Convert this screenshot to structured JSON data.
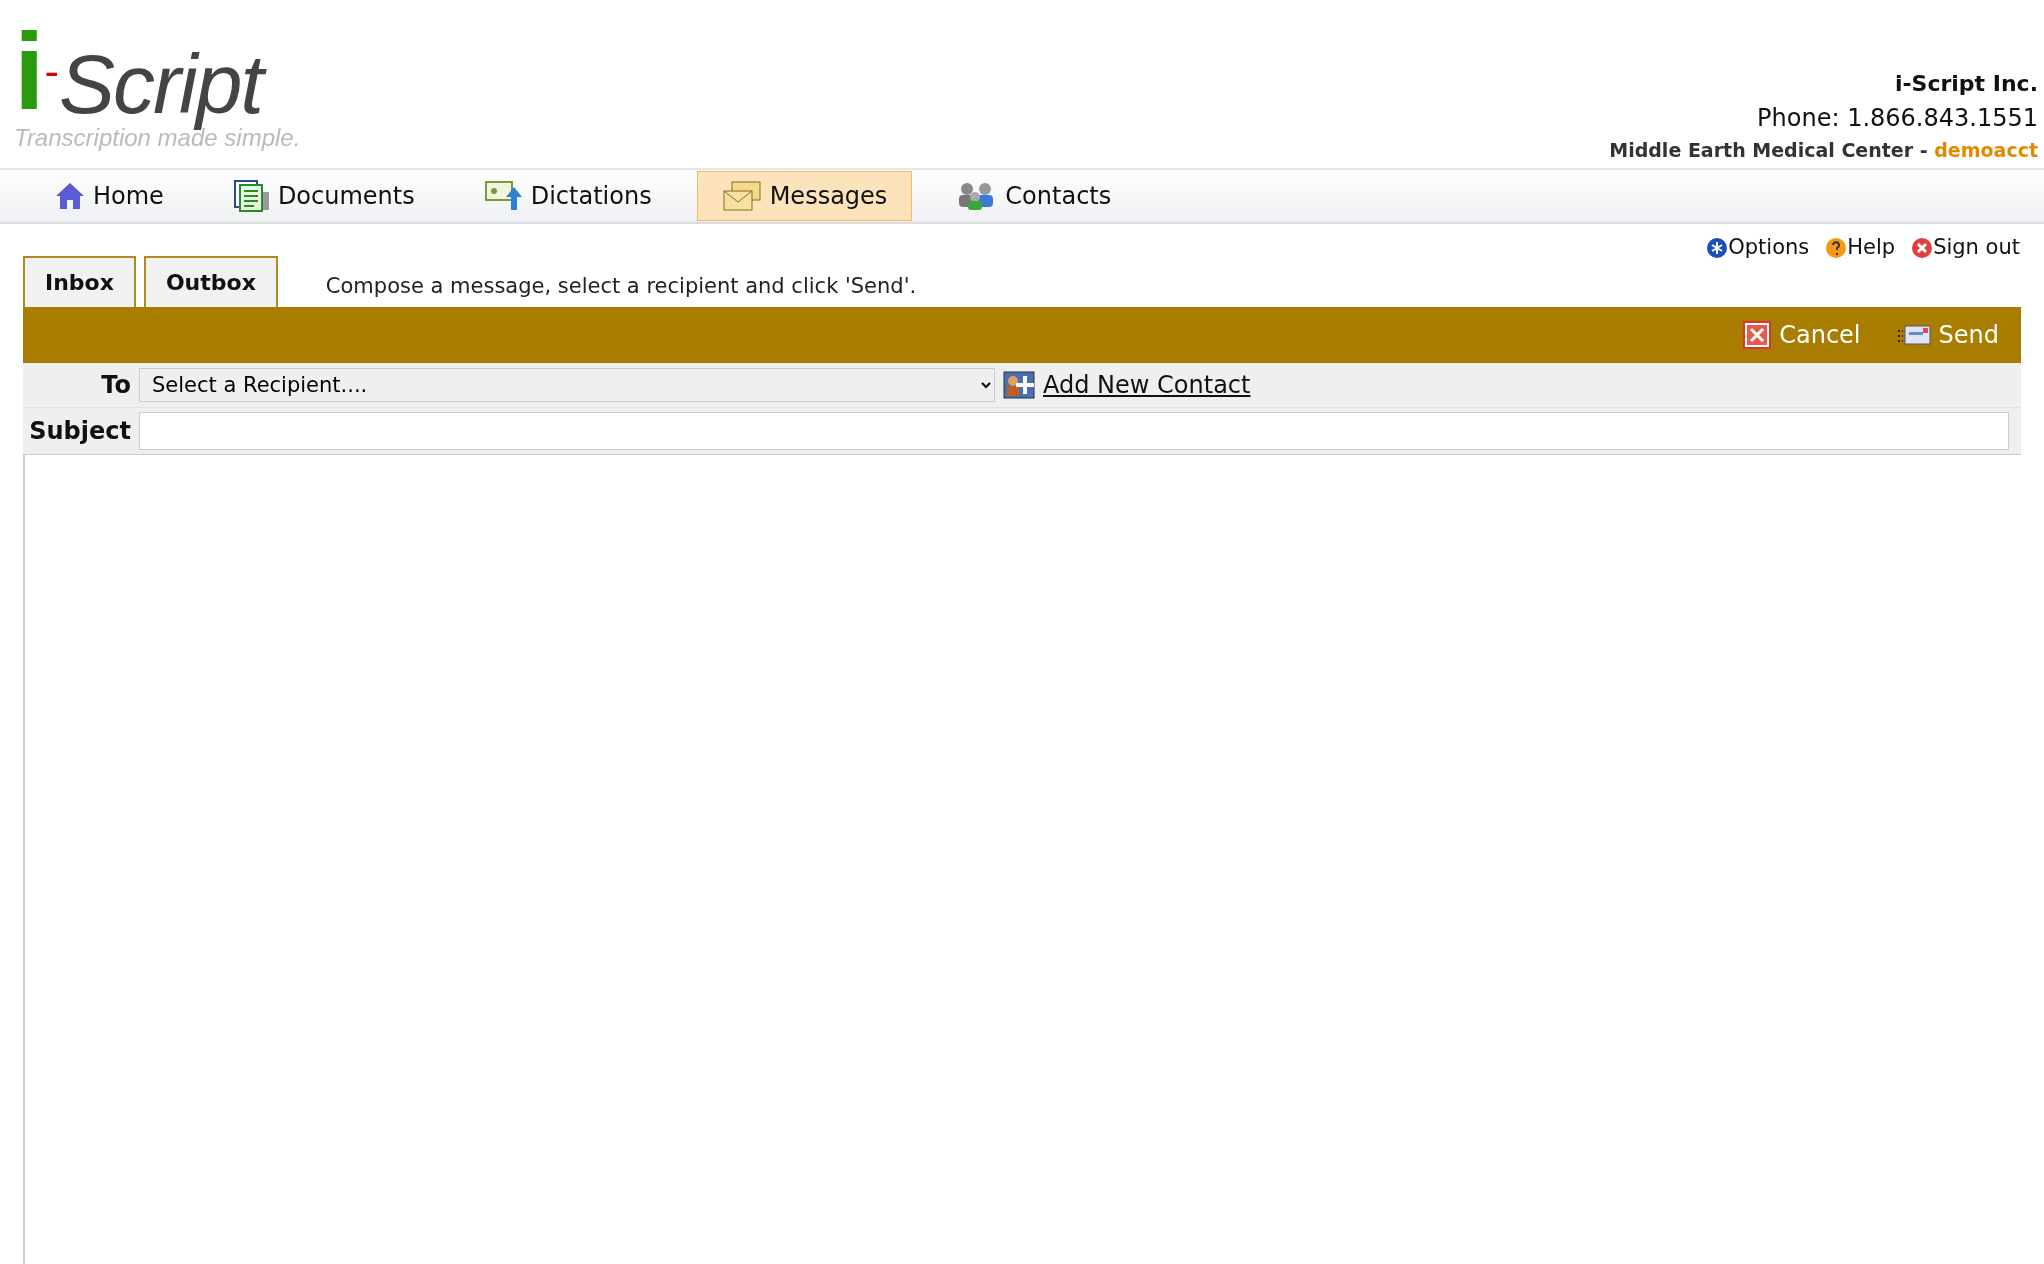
{
  "logo": {
    "letter": "i",
    "dash": "-",
    "word": "Script",
    "tagline": "Transcription made simple."
  },
  "company": {
    "name": "i-Script Inc.",
    "phone": "Phone: 1.866.843.1551",
    "facility": "Middle Earth Medical Center - ",
    "account": "demoacct"
  },
  "nav": [
    {
      "label": "Home",
      "kind": "home",
      "selected": false
    },
    {
      "label": "Documents",
      "kind": "documents",
      "selected": false
    },
    {
      "label": "Dictations",
      "kind": "dictations",
      "selected": false
    },
    {
      "label": "Messages",
      "kind": "messages",
      "selected": true
    },
    {
      "label": "Contacts",
      "kind": "contacts",
      "selected": false
    }
  ],
  "links": [
    {
      "label": "Options",
      "kind": "options"
    },
    {
      "label": "Help",
      "kind": "help"
    },
    {
      "label": "Sign out",
      "kind": "signout"
    }
  ],
  "tabs": [
    "Inbox",
    "Outbox"
  ],
  "instruction": "Compose a message, select a recipient and click 'Send'.",
  "actions": [
    {
      "label": "Cancel",
      "kind": "cancel"
    },
    {
      "label": "Send",
      "kind": "send"
    }
  ],
  "form": {
    "to_label": "To",
    "recipient": "Select a Recipient....",
    "add_contact": "Add New Contact",
    "subject_label": "Subject"
  }
}
